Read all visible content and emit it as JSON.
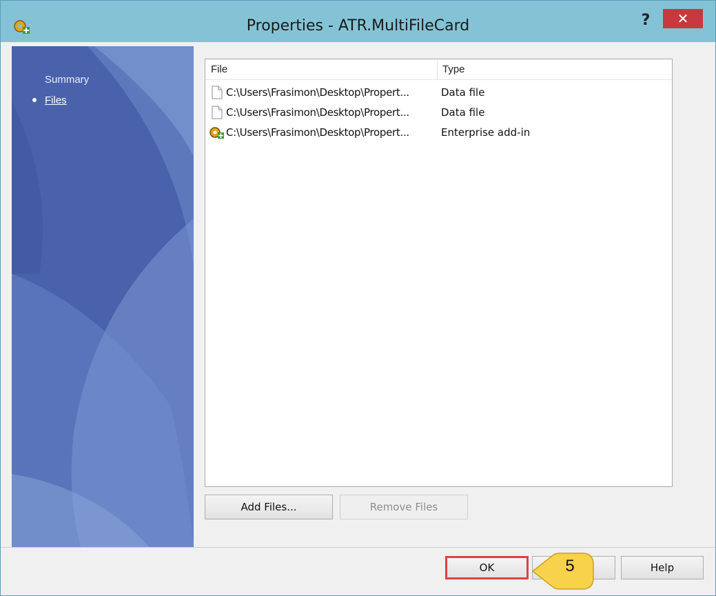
{
  "window": {
    "title": "Properties - ATR.MultiFileCard",
    "help_glyph": "?",
    "close_glyph": "✕"
  },
  "nav": {
    "items": [
      {
        "label": "Summary",
        "active": false
      },
      {
        "label": "Files",
        "active": true
      }
    ]
  },
  "files_list": {
    "columns": [
      "File",
      "Type"
    ],
    "rows": [
      {
        "path": "C:\\Users\\Frasimon\\Desktop\\Propert...",
        "type": "Data file",
        "icon": "document-icon"
      },
      {
        "path": "C:\\Users\\Frasimon\\Desktop\\Propert...",
        "type": "Data file",
        "icon": "document-icon"
      },
      {
        "path": "C:\\Users\\Frasimon\\Desktop\\Propert...",
        "type": "Enterprise add-in",
        "icon": "addin-icon"
      }
    ]
  },
  "buttons": {
    "add_files": "Add Files...",
    "remove_files": "Remove Files",
    "ok": "OK",
    "help": "Help"
  },
  "callout": {
    "step": "5"
  },
  "colors": {
    "titlebar": "#84c3d6",
    "close": "#c9383e",
    "panel": "#4a65ae",
    "highlight": "#e04040",
    "callout": "#f7d24a"
  }
}
